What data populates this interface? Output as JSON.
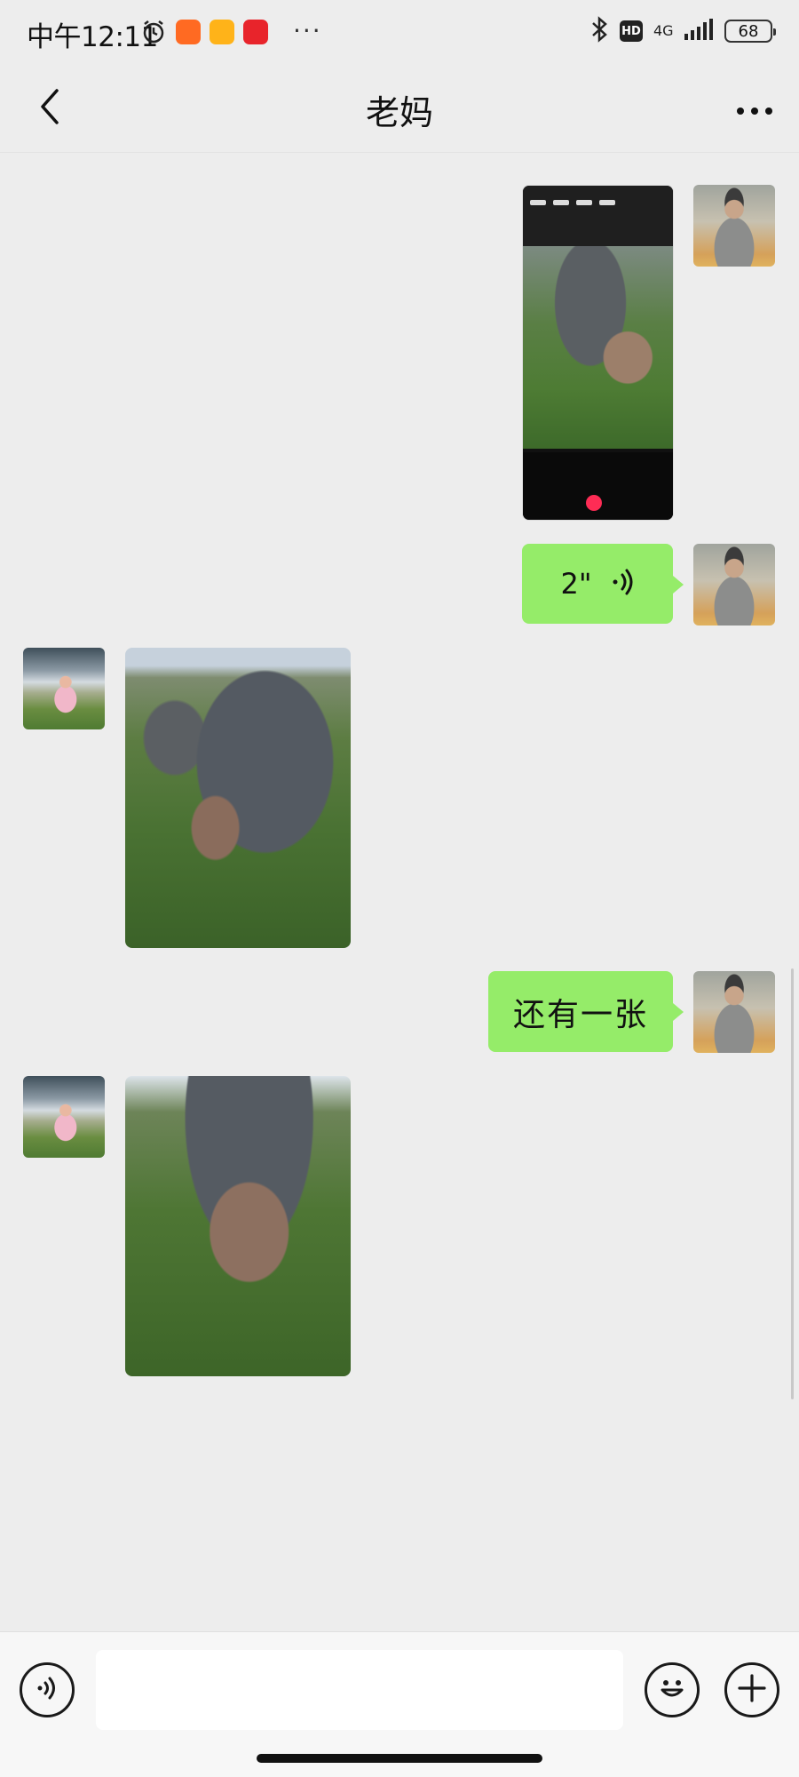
{
  "status_bar": {
    "time": "中午12:11",
    "icons": [
      "alarm-icon",
      "mi-store-app-icon",
      "notes-app-icon",
      "red-app-icon"
    ],
    "more": "···",
    "hd": "HD",
    "network": "4G",
    "battery": "68"
  },
  "header": {
    "title": "老妈",
    "back_icon": "chevron-left-icon",
    "more_icon": "more-dots-icon"
  },
  "messages": [
    {
      "sender": "me",
      "type": "image",
      "description": "phone-screenshot"
    },
    {
      "sender": "me",
      "type": "voice",
      "duration": "2\""
    },
    {
      "sender": "contact",
      "type": "image",
      "description": "photo"
    },
    {
      "sender": "me",
      "type": "text",
      "text": "还有一张"
    },
    {
      "sender": "contact",
      "type": "image",
      "description": "photo"
    }
  ],
  "input_bar": {
    "voice_icon": "voice-mode-icon",
    "emoji_icon": "emoji-icon",
    "plus_icon": "plus-icon",
    "value": ""
  },
  "colors": {
    "background": "#ededed",
    "bubble_green": "#95ec69",
    "input_bar": "#f7f7f7"
  }
}
